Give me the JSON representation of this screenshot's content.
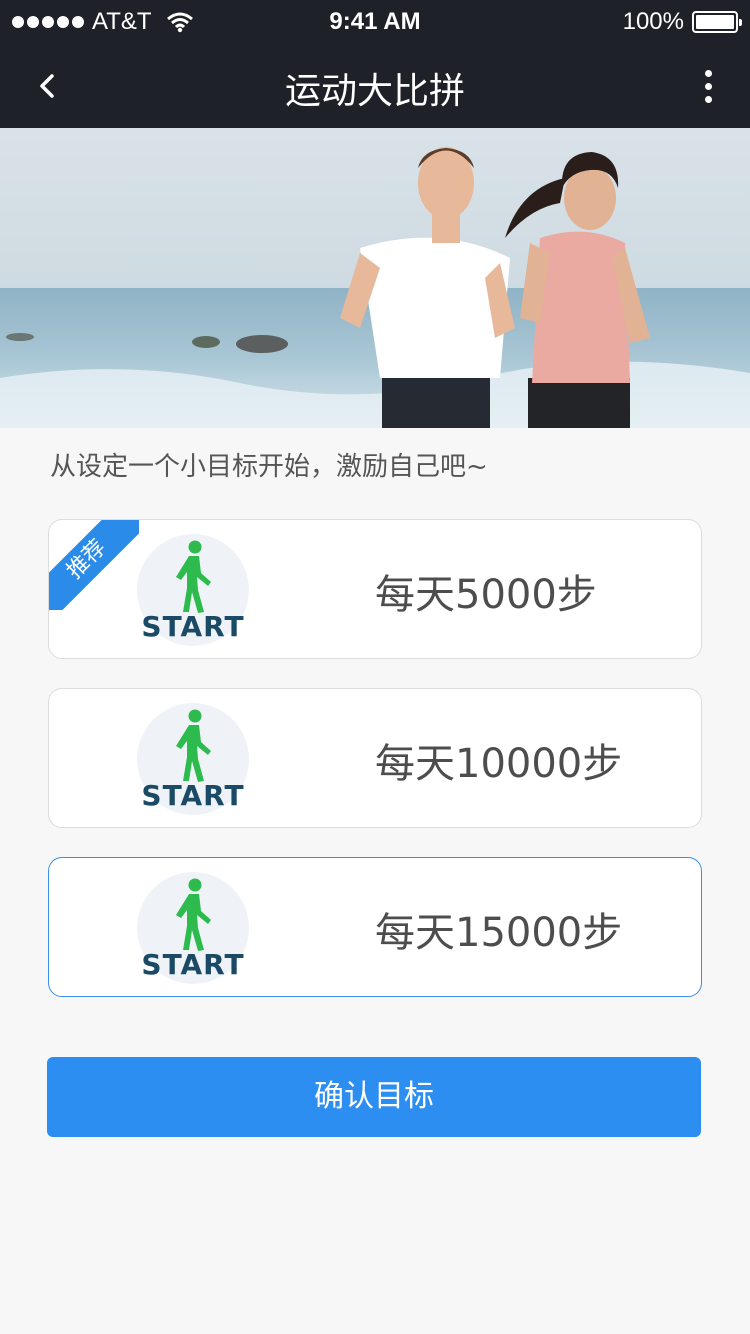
{
  "status_bar": {
    "carrier": "AT&T",
    "time": "9:41 AM",
    "battery": "100%"
  },
  "nav": {
    "title": "运动大比拼",
    "back_icon": "chevron-left-icon",
    "more_icon": "more-vertical-icon"
  },
  "prompt": "从设定一个小目标开始，激励自己吧~",
  "goals": [
    {
      "label": "每天5000步",
      "start_text": "START",
      "ribbon": "推荐"
    },
    {
      "label": "每天10000步",
      "start_text": "START"
    },
    {
      "label": "每天15000步",
      "start_text": "START"
    }
  ],
  "confirm_label": "确认目标",
  "colors": {
    "nav_bg": "#1e2127",
    "accent": "#2c8ef0",
    "walk_icon": "#2dbb4e",
    "start_text": "#1a4a66"
  }
}
